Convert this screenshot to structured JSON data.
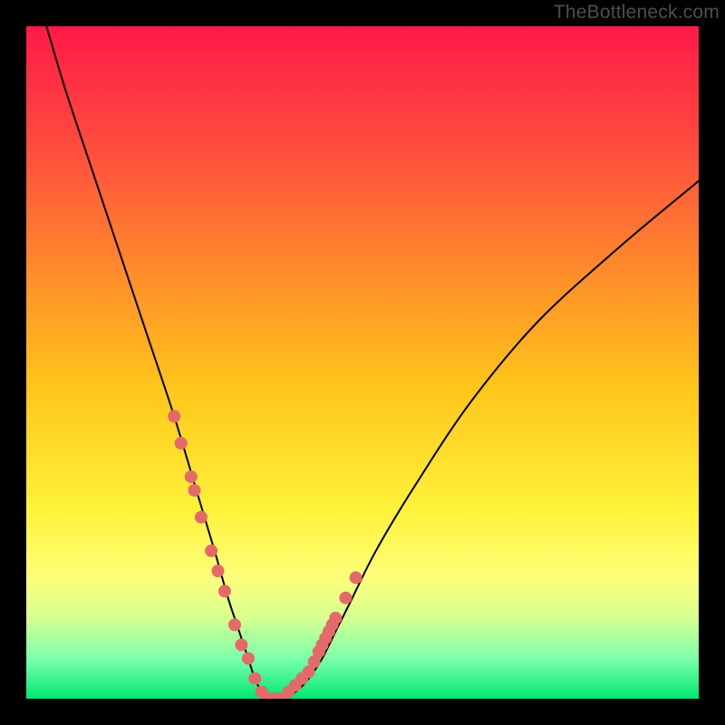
{
  "watermark": "TheBottleneck.com",
  "chart_data": {
    "type": "line",
    "title": "",
    "xlabel": "",
    "ylabel": "",
    "xlim": [
      0,
      100
    ],
    "ylim": [
      0,
      100
    ],
    "grid": false,
    "series": [
      {
        "name": "curve",
        "x": [
          3,
          6,
          10,
          14,
          18,
          22,
          25,
          28,
          30,
          32,
          33,
          34,
          35,
          36,
          38,
          40,
          42,
          44,
          46,
          48,
          52,
          58,
          66,
          76,
          88,
          100
        ],
        "y": [
          100,
          90,
          78,
          66,
          54,
          42,
          32,
          22,
          15,
          9,
          6,
          3,
          1,
          0,
          0,
          1,
          3,
          6,
          10,
          14,
          22,
          32,
          44,
          56,
          67,
          77
        ]
      }
    ],
    "scatter_points": {
      "name": "highlighted-points",
      "x": [
        22,
        23,
        24.5,
        25,
        26,
        27.5,
        28.5,
        29.5,
        31,
        32,
        33,
        34,
        35,
        36,
        37,
        38,
        39,
        40,
        41,
        42,
        42.8,
        43.5,
        44,
        44.5,
        45,
        45.5,
        46,
        47.5,
        49
      ],
      "y": [
        42,
        38,
        33,
        31,
        27,
        22,
        19,
        16,
        11,
        8,
        6,
        3,
        1,
        0,
        0,
        0,
        1,
        2,
        3,
        4,
        5.5,
        7,
        8,
        9,
        10,
        11,
        12,
        15,
        18
      ]
    },
    "background_gradient": {
      "top": "#ff1a49",
      "bottom": "#00e873"
    }
  }
}
